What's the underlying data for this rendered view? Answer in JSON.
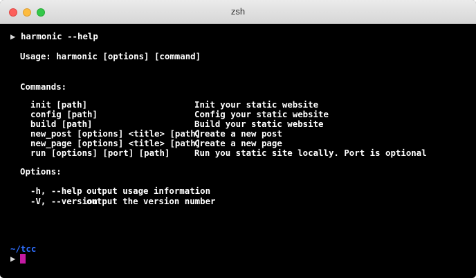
{
  "window": {
    "title": "zsh"
  },
  "terminal": {
    "prompt_symbol": "▶",
    "command": "harmonic --help",
    "usage": "Usage: harmonic [options] [command]",
    "commands_header": "Commands:",
    "commands": [
      {
        "name": "init [path]",
        "description": "Init your static website"
      },
      {
        "name": "config [path]",
        "description": "Config your static website"
      },
      {
        "name": "build [path]",
        "description": "Build your static website"
      },
      {
        "name": "new_post [options] <title> [path]",
        "description": "Create a new post"
      },
      {
        "name": "new_page [options] <title> [path]",
        "description": "Create a new page"
      },
      {
        "name": "run [options] [port] [path]",
        "description": "Run you static site locally. Port is optional"
      }
    ],
    "options_header": "Options:",
    "options": [
      {
        "flag": "-h, --help",
        "description": "output usage information"
      },
      {
        "flag": "-V, --version",
        "description": "output the version number"
      }
    ],
    "cwd": "~/tcc"
  },
  "colors": {
    "background": "#000000",
    "text": "#ffffff",
    "cwd": "#2f6fff",
    "cursor": "#c41aa3"
  }
}
